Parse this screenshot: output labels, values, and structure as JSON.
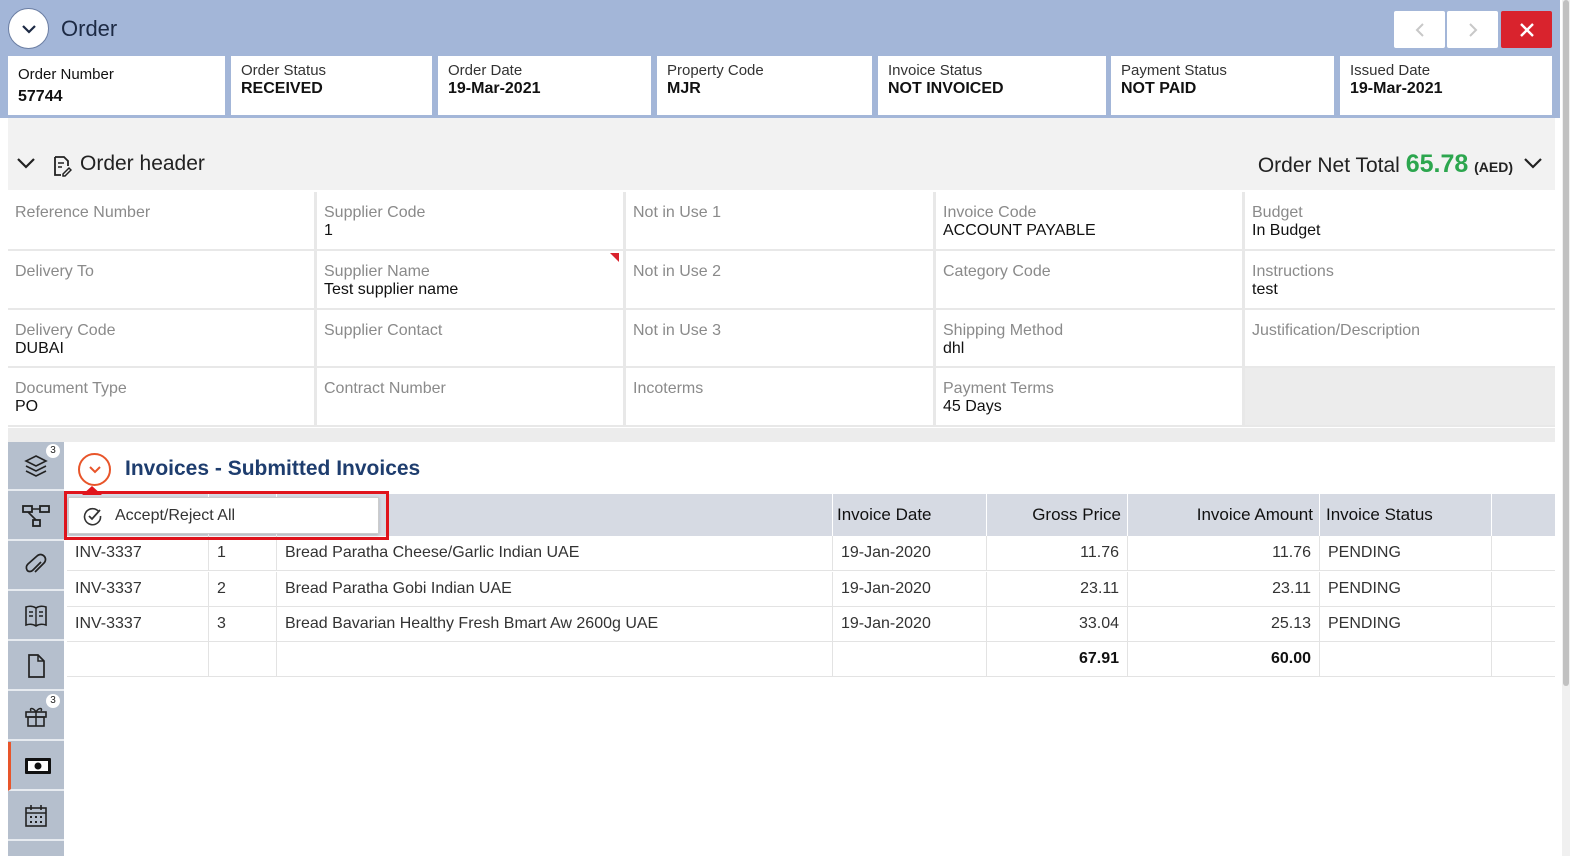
{
  "window": {
    "title": "Order"
  },
  "summary": [
    {
      "label": "Order Number",
      "value": "57744"
    },
    {
      "label": "Order Status",
      "value": "RECEIVED"
    },
    {
      "label": "Order Date",
      "value": "19-Mar-2021"
    },
    {
      "label": "Property Code",
      "value": "MJR"
    },
    {
      "label": "Invoice Status",
      "value": "NOT INVOICED"
    },
    {
      "label": "Payment Status",
      "value": "NOT PAID"
    },
    {
      "label": "Issued Date",
      "value": "19-Mar-2021"
    }
  ],
  "order_header": {
    "title": "Order header",
    "net_total_label": "Order Net Total",
    "net_total_value": "65.78",
    "currency": "(AED)",
    "fields": [
      {
        "label": "Reference Number",
        "value": ""
      },
      {
        "label": "Supplier Code",
        "value": "1"
      },
      {
        "label": "Not in Use 1",
        "value": ""
      },
      {
        "label": "Invoice Code",
        "value": "ACCOUNT PAYABLE"
      },
      {
        "label": "Budget",
        "value": "In Budget"
      },
      {
        "label": "Delivery To",
        "value": ""
      },
      {
        "label": "Supplier Name",
        "value": "Test supplier name"
      },
      {
        "label": "Not in Use 2",
        "value": ""
      },
      {
        "label": "Category Code",
        "value": ""
      },
      {
        "label": "Instructions",
        "value": "test"
      },
      {
        "label": "Delivery Code",
        "value": "DUBAI"
      },
      {
        "label": "Supplier Contact",
        "value": ""
      },
      {
        "label": "Not in Use 3",
        "value": ""
      },
      {
        "label": "Shipping Method",
        "value": "dhl"
      },
      {
        "label": "Justification/Description",
        "value": ""
      },
      {
        "label": "Document Type",
        "value": "PO"
      },
      {
        "label": "Contract Number",
        "value": ""
      },
      {
        "label": "Incoterms",
        "value": ""
      },
      {
        "label": "Payment Terms",
        "value": "45 Days"
      }
    ]
  },
  "sidebar": {
    "items": [
      {
        "icon": "layers-icon",
        "badge": "3"
      },
      {
        "icon": "hierarchy-icon",
        "badge": ""
      },
      {
        "icon": "paperclip-icon",
        "badge": ""
      },
      {
        "icon": "book-icon",
        "badge": ""
      },
      {
        "icon": "document-icon",
        "badge": ""
      },
      {
        "icon": "gift-icon",
        "badge": "3"
      },
      {
        "icon": "money-icon",
        "badge": "",
        "active": true
      },
      {
        "icon": "calendar-icon",
        "badge": ""
      }
    ]
  },
  "invoices": {
    "title": "Invoices - Submitted Invoices",
    "accept_reject_label": "Accept/Reject All",
    "columns": [
      "",
      "",
      "",
      "Invoice Date",
      "Gross Price",
      "Invoice Amount",
      "Invoice Status",
      ""
    ],
    "rows": [
      {
        "invoice": "INV-3337",
        "line": "1",
        "item": "Bread Paratha Cheese/Garlic Indian UAE",
        "date": "19-Jan-2020",
        "gross": "11.76",
        "amount": "11.76",
        "status": "PENDING"
      },
      {
        "invoice": "INV-3337",
        "line": "2",
        "item": "Bread Paratha Gobi Indian UAE",
        "date": "19-Jan-2020",
        "gross": "23.11",
        "amount": "23.11",
        "status": "PENDING"
      },
      {
        "invoice": "INV-3337",
        "line": "3",
        "item": "Bread Bavarian Healthy Fresh Bmart Aw 2600g UAE",
        "date": "19-Jan-2020",
        "gross": "33.04",
        "amount": "25.13",
        "status": "PENDING"
      }
    ],
    "totals": {
      "gross": "67.91",
      "amount": "60.00"
    }
  },
  "colors": {
    "accent": "#e8552a",
    "total_green": "#2ca64e",
    "close_red": "#d9232d",
    "title_bar": "#a3b6d8"
  }
}
